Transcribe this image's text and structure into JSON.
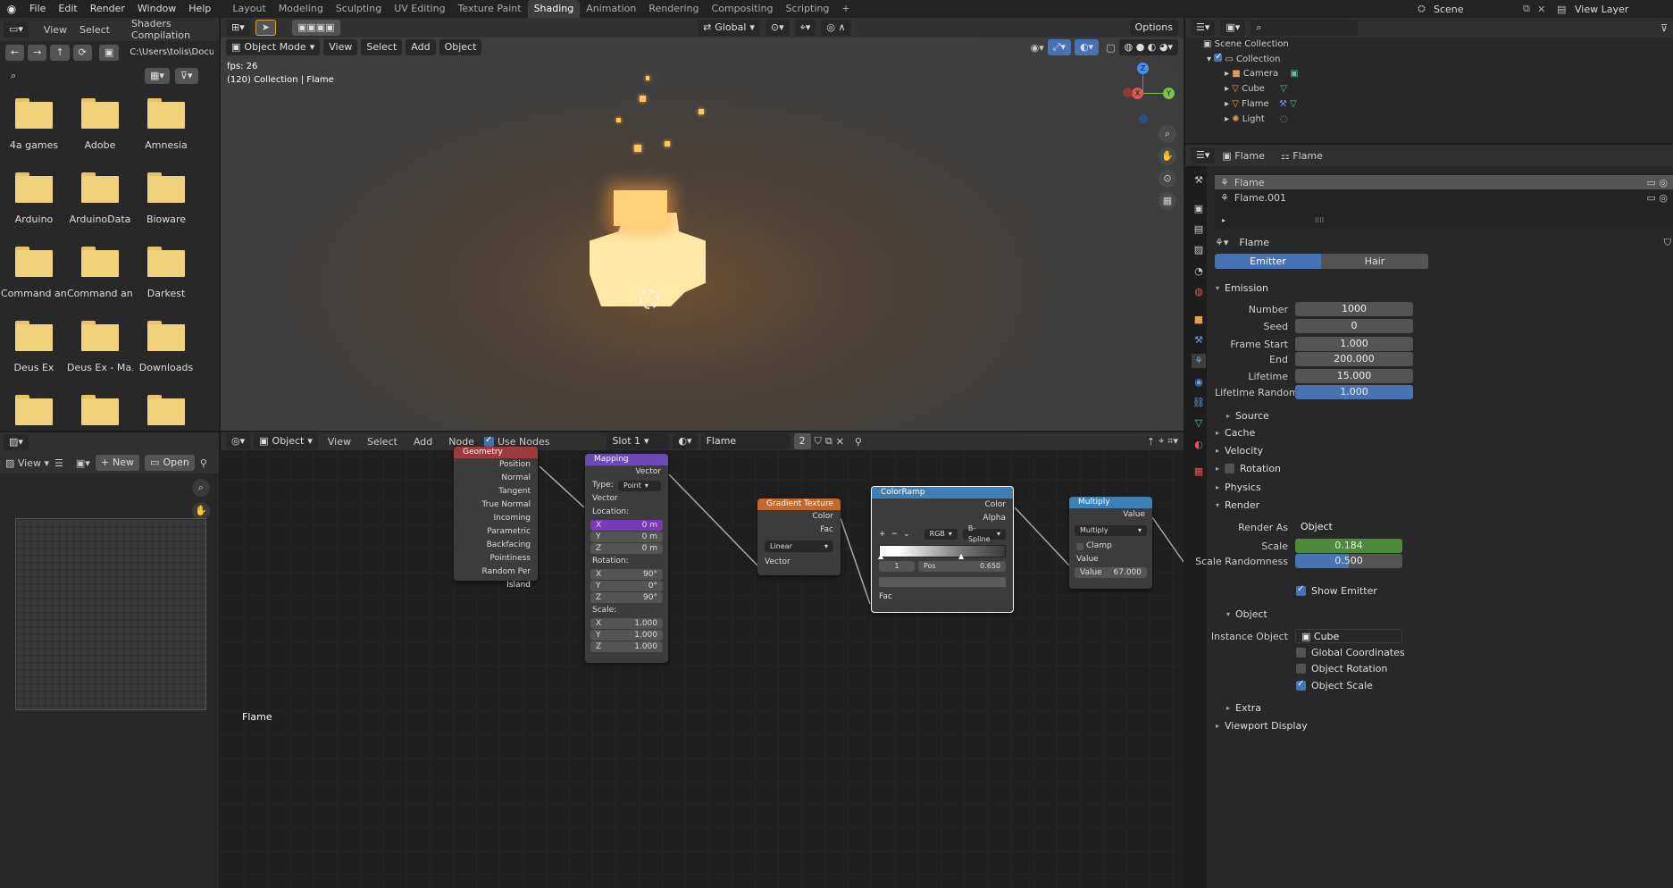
{
  "topbar": {
    "menus": [
      "File",
      "Edit",
      "Render",
      "Window",
      "Help"
    ],
    "workspaces": [
      "Layout",
      "Modeling",
      "Sculpting",
      "UV Editing",
      "Texture Paint",
      "Shading",
      "Animation",
      "Rendering",
      "Compositing",
      "Scripting"
    ],
    "active_workspace": "Shading",
    "plus": "+",
    "scene": "Scene",
    "view_layer": "View Layer"
  },
  "file_browser": {
    "header": {
      "view": "View",
      "select": "Select",
      "bookmark": "Shaders Compilation"
    },
    "path": "C:\\Users\\tolis\\Docume...",
    "folders": [
      "4a games",
      "Adobe",
      "Amnesia",
      "Arduino",
      "ArduinoData",
      "Bioware",
      "Command an...",
      "Command an...",
      "Darkest",
      "Deus Ex",
      "Deus Ex - Ma...",
      "Downloads",
      "",
      "",
      ""
    ]
  },
  "image_editor": {
    "view": "View",
    "new": "New",
    "open": "Open"
  },
  "viewport": {
    "mode": "Object Mode",
    "view": "View",
    "select": "Select",
    "add": "Add",
    "object": "Object",
    "transform": "Global",
    "options": "Options",
    "fps": "fps: 26",
    "collection_info": "(120) Collection | Flame",
    "gizmo": {
      "x": "X",
      "y": "Y",
      "z": "Z"
    }
  },
  "node_editor": {
    "type": "Object",
    "view": "View",
    "select": "Select",
    "add": "Add",
    "node": "Node",
    "use_nodes": "Use Nodes",
    "slot": "Slot 1",
    "material": "Flame",
    "users": "2",
    "footer_label": "Flame",
    "geometry": {
      "title": "Geometry",
      "outputs": [
        "Position",
        "Normal",
        "Tangent",
        "True Normal",
        "Incoming",
        "Parametric",
        "Backfacing",
        "Pointiness",
        "Random Per Island"
      ]
    },
    "mapping": {
      "title": "Mapping",
      "out": "Vector",
      "type_lbl": "Type:",
      "type_val": "Point",
      "vector": "Vector",
      "location": "Location:",
      "loc": [
        [
          "X",
          "0 m"
        ],
        [
          "Y",
          "0 m"
        ],
        [
          "Z",
          "0 m"
        ]
      ],
      "rotation": "Rotation:",
      "rot": [
        [
          "X",
          "90°"
        ],
        [
          "Y",
          "0°"
        ],
        [
          "Z",
          "90°"
        ]
      ],
      "scale": "Scale:",
      "scl": [
        [
          "X",
          "1.000"
        ],
        [
          "Y",
          "1.000"
        ],
        [
          "Z",
          "1.000"
        ]
      ]
    },
    "gradient": {
      "title": "Gradient Texture",
      "color": "Color",
      "fac": "Fac",
      "type": "Linear",
      "vector": "Vector"
    },
    "colorramp": {
      "title": "ColorRamp",
      "color": "Color",
      "alpha": "Alpha",
      "mode": "RGB",
      "interp": "B-Spline",
      "index": "1",
      "pos_lbl": "Pos",
      "pos": "0.650",
      "fac": "Fac"
    },
    "multiply": {
      "title": "Multiply",
      "value": "Value",
      "op": "Multiply",
      "clamp": "Clamp",
      "in_value": "Value",
      "field_lbl": "Value",
      "field_val": "67.000"
    }
  },
  "outliner": {
    "root": "Scene Collection",
    "collection": "Collection",
    "items": [
      "Camera",
      "Cube",
      "Flame",
      "Light"
    ]
  },
  "properties": {
    "object": "Flame",
    "data": "Flame",
    "systems": [
      "Flame",
      "Flame.001"
    ],
    "settings": "Flame",
    "emitter": "Emitter",
    "hair": "Hair",
    "emission": "Emission",
    "rows": [
      {
        "label": "Number",
        "value": "1000"
      },
      {
        "label": "Seed",
        "value": "0"
      },
      {
        "label": "Frame Start",
        "value": "1.000"
      },
      {
        "label": "End",
        "value": "200.000"
      },
      {
        "label": "Lifetime",
        "value": "15.000"
      },
      {
        "label": "Lifetime Randomn...",
        "value": "1.000"
      }
    ],
    "source": "Source",
    "cache": "Cache",
    "velocity": "Velocity",
    "rotation": "Rotation",
    "physics": "Physics",
    "render": "Render",
    "render_as_lbl": "Render As",
    "render_as": "Object",
    "scale_lbl": "Scale",
    "scale": "0.184",
    "scale_rand_lbl": "Scale Randomness",
    "scale_rand": "0.500",
    "show_emitter": "Show Emitter",
    "object_sec": "Object",
    "instance_lbl": "Instance Object",
    "instance": "Cube",
    "global_coords": "Global Coordinates",
    "obj_rot": "Object Rotation",
    "obj_scale": "Object Scale",
    "extra": "Extra",
    "viewport_display": "Viewport Display"
  }
}
